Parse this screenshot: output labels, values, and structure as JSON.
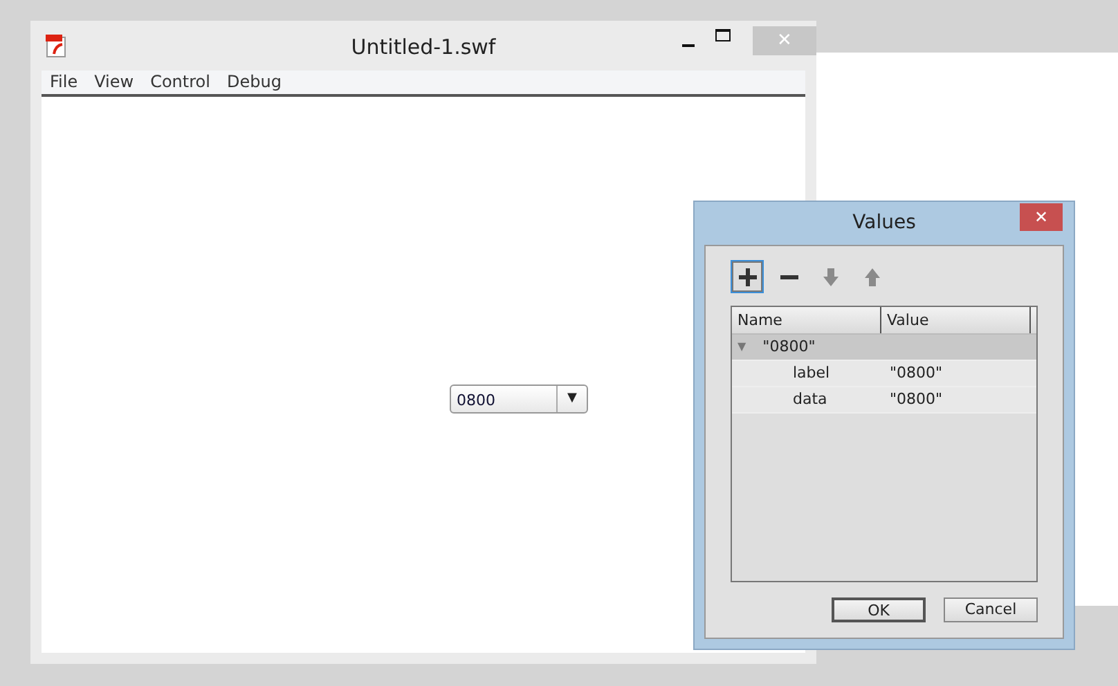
{
  "window": {
    "title": "Untitled-1.swf",
    "close": "✕"
  },
  "menu": [
    "File",
    "View",
    "Control",
    "Debug"
  ],
  "combo": {
    "value": "0800",
    "arrow": "▼"
  },
  "dialog": {
    "title": "Values",
    "close": "✕",
    "toolbar": [
      {
        "kind": "add",
        "disabled": false,
        "selected": true
      },
      {
        "kind": "remove",
        "disabled": false,
        "selected": false
      },
      {
        "kind": "down",
        "disabled": true,
        "selected": false
      },
      {
        "kind": "up",
        "disabled": true,
        "selected": false
      }
    ],
    "columns": [
      "Name",
      "Value"
    ],
    "tree": [
      {
        "name": "\"0800\"",
        "expanded": true,
        "selected": true,
        "children": [
          {
            "name": "label",
            "value": "\"0800\"",
            "selected": false
          },
          {
            "name": "data",
            "value": "\"0800\"",
            "selected": false
          }
        ]
      }
    ],
    "buttons": [
      {
        "label": "OK",
        "default": true
      },
      {
        "label": "Cancel",
        "default": false
      }
    ]
  }
}
